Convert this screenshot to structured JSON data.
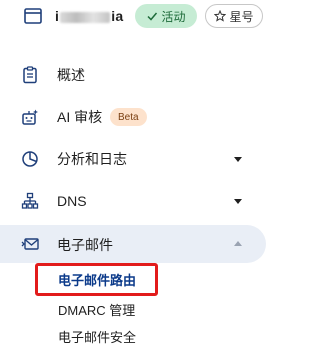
{
  "header": {
    "site_name_prefix": "i",
    "site_name_suffix": "ia",
    "status_label": "活动",
    "star_label": "星号"
  },
  "nav": {
    "overview": "概述",
    "ai_review": "AI 审核",
    "beta": "Beta",
    "analytics": "分析和日志",
    "dns": "DNS",
    "email": "电子邮件"
  },
  "email_sub": {
    "routing": "电子邮件路由",
    "dmarc": "DMARC 管理",
    "security": "电子邮件安全"
  },
  "colors": {
    "accent": "#0b3a8a",
    "active_badge": "#c6ecd4",
    "beta_badge": "#fde2cc",
    "highlight": "#e21b1b"
  }
}
